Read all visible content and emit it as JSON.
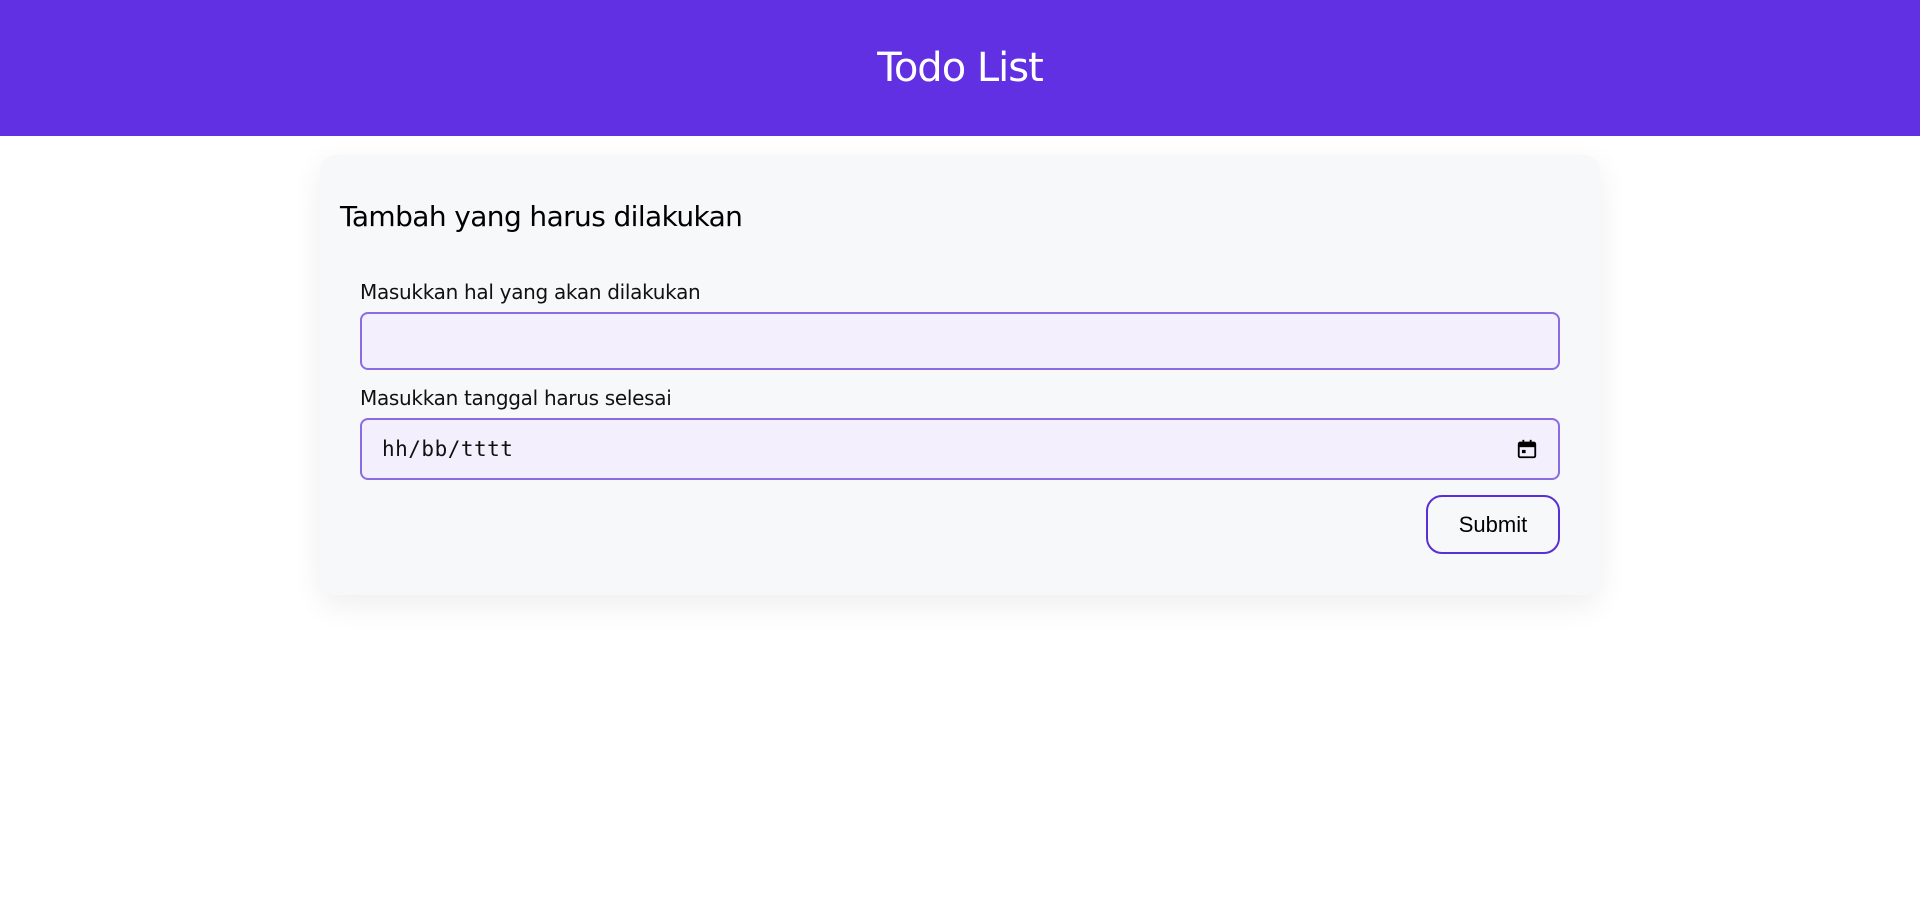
{
  "header": {
    "title": "Todo List",
    "background_color": "#6130e3"
  },
  "form": {
    "title": "Tambah yang harus dilakukan",
    "todo_field": {
      "label": "Masukkan hal yang akan dilakukan",
      "value": "",
      "placeholder": ""
    },
    "date_field": {
      "label": "Masukkan tanggal harus selesai",
      "placeholder": "hh/bb/tttt",
      "icon": "calendar-icon"
    },
    "submit_label": "Submit"
  },
  "colors": {
    "accent": "#6130e3",
    "input_border": "#8b6be3",
    "input_background": "#f3effd",
    "card_background": "#f7f8fa"
  }
}
